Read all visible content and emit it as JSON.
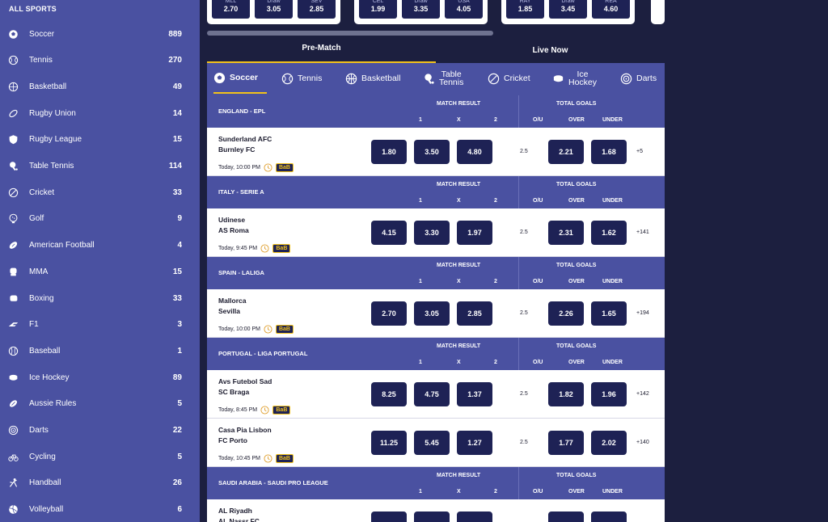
{
  "sidebar": {
    "title": "ALL SPORTS",
    "items": [
      {
        "label": "Soccer",
        "count": "889",
        "icon": "soccer-ball-icon"
      },
      {
        "label": "Tennis",
        "count": "270",
        "icon": "tennis-ball-icon"
      },
      {
        "label": "Basketball",
        "count": "49",
        "icon": "basketball-icon"
      },
      {
        "label": "Rugby Union",
        "count": "14",
        "icon": "rugby-ball-icon"
      },
      {
        "label": "Rugby League",
        "count": "15",
        "icon": "shield-icon"
      },
      {
        "label": "Table Tennis",
        "count": "114",
        "icon": "table-tennis-icon"
      },
      {
        "label": "Cricket",
        "count": "33",
        "icon": "cricket-ball-icon"
      },
      {
        "label": "Golf",
        "count": "9",
        "icon": "golf-ball-icon"
      },
      {
        "label": "American Football",
        "count": "4",
        "icon": "american-football-icon"
      },
      {
        "label": "MMA",
        "count": "15",
        "icon": "glove-icon"
      },
      {
        "label": "Boxing",
        "count": "33",
        "icon": "boxing-glove-icon"
      },
      {
        "label": "F1",
        "count": "3",
        "icon": "f1-icon"
      },
      {
        "label": "Baseball",
        "count": "1",
        "icon": "baseball-icon"
      },
      {
        "label": "Ice Hockey",
        "count": "89",
        "icon": "hockey-puck-icon"
      },
      {
        "label": "Aussie Rules",
        "count": "5",
        "icon": "aussie-rules-ball-icon"
      },
      {
        "label": "Darts",
        "count": "22",
        "icon": "dartboard-icon"
      },
      {
        "label": "Cycling",
        "count": "5",
        "icon": "bicycle-icon"
      },
      {
        "label": "Handball",
        "count": "26",
        "icon": "handball-player-icon"
      },
      {
        "label": "Volleyball",
        "count": "6",
        "icon": "volleyball-icon"
      }
    ]
  },
  "top_strip": {
    "cards": [
      {
        "odds": [
          {
            "label": "MLL",
            "value": "2.70"
          },
          {
            "label": "Draw",
            "value": "3.05"
          },
          {
            "label": "SEV",
            "value": "2.85"
          }
        ]
      },
      {
        "odds": [
          {
            "label": "CEL",
            "value": "1.99"
          },
          {
            "label": "Draw",
            "value": "3.35"
          },
          {
            "label": "USA",
            "value": "4.05"
          }
        ]
      },
      {
        "odds": [
          {
            "label": "RAY",
            "value": "1.85"
          },
          {
            "label": "Draw",
            "value": "3.45"
          },
          {
            "label": "REA",
            "value": "4.60"
          }
        ]
      }
    ]
  },
  "mode_tabs": {
    "pre_match": "Pre-Match",
    "live_now": "Live Now"
  },
  "sport_tabs": {
    "soccer": "Soccer",
    "tennis": "Tennis",
    "basketball": "Basketball",
    "table_tennis_1": "Table",
    "table_tennis_2": "Tennis",
    "cricket": "Cricket",
    "ice_hockey_1": "Ice",
    "ice_hockey_2": "Hockey",
    "darts": "Darts"
  },
  "headers": {
    "match_result": "MATCH RESULT",
    "total_goals": "TOTAL GOALS",
    "col_1": "1",
    "col_x": "X",
    "col_2": "2",
    "col_ou": "O/U",
    "col_over": "OVER",
    "col_under": "UNDER"
  },
  "leagues": [
    {
      "name": "ENGLAND - EPL",
      "matches": [
        {
          "home": "Sunderland AFC",
          "away": "Burnley FC",
          "time": "Today, 10:00 PM",
          "badge": "BaB",
          "o1": "1.80",
          "ox": "3.50",
          "o2": "4.80",
          "line": "2.5",
          "over": "2.21",
          "under": "1.68",
          "more": "+5"
        }
      ]
    },
    {
      "name": "ITALY - SERIE A",
      "matches": [
        {
          "home": "Udinese",
          "away": "AS Roma",
          "time": "Today, 9:45 PM",
          "badge": "BaB",
          "o1": "4.15",
          "ox": "3.30",
          "o2": "1.97",
          "line": "2.5",
          "over": "2.31",
          "under": "1.62",
          "more": "+141"
        }
      ]
    },
    {
      "name": "SPAIN - LALIGA",
      "matches": [
        {
          "home": "Mallorca",
          "away": "Sevilla",
          "time": "Today, 10:00 PM",
          "badge": "BaB",
          "o1": "2.70",
          "ox": "3.05",
          "o2": "2.85",
          "line": "2.5",
          "over": "2.26",
          "under": "1.65",
          "more": "+194"
        }
      ]
    },
    {
      "name": "PORTUGAL - LIGA PORTUGAL",
      "matches": [
        {
          "home": "Avs Futebol Sad",
          "away": "SC Braga",
          "time": "Today, 8:45 PM",
          "badge": "BaB",
          "o1": "8.25",
          "ox": "4.75",
          "o2": "1.37",
          "line": "2.5",
          "over": "1.82",
          "under": "1.96",
          "more": "+142"
        },
        {
          "home": "Casa Pia Lisbon",
          "away": "FC Porto",
          "time": "Today, 10:45 PM",
          "badge": "BaB",
          "o1": "11.25",
          "ox": "5.45",
          "o2": "1.27",
          "line": "2.5",
          "over": "1.77",
          "under": "2.02",
          "more": "+140"
        }
      ]
    },
    {
      "name": "SAUDI ARABIA - SAUDI PRO LEAGUE",
      "matches": [
        {
          "home": "AL Riyadh",
          "away": "AL Nassr FC",
          "time": "",
          "badge": "",
          "o1": "",
          "ox": "",
          "o2": "",
          "line": "",
          "over": "",
          "under": "",
          "more": ""
        }
      ]
    }
  ],
  "colors": {
    "sidebar_bg": "#4a51a1",
    "page_bg": "#1c1f3f",
    "odds_button": "#1e2255",
    "accent": "#f2c21a"
  }
}
